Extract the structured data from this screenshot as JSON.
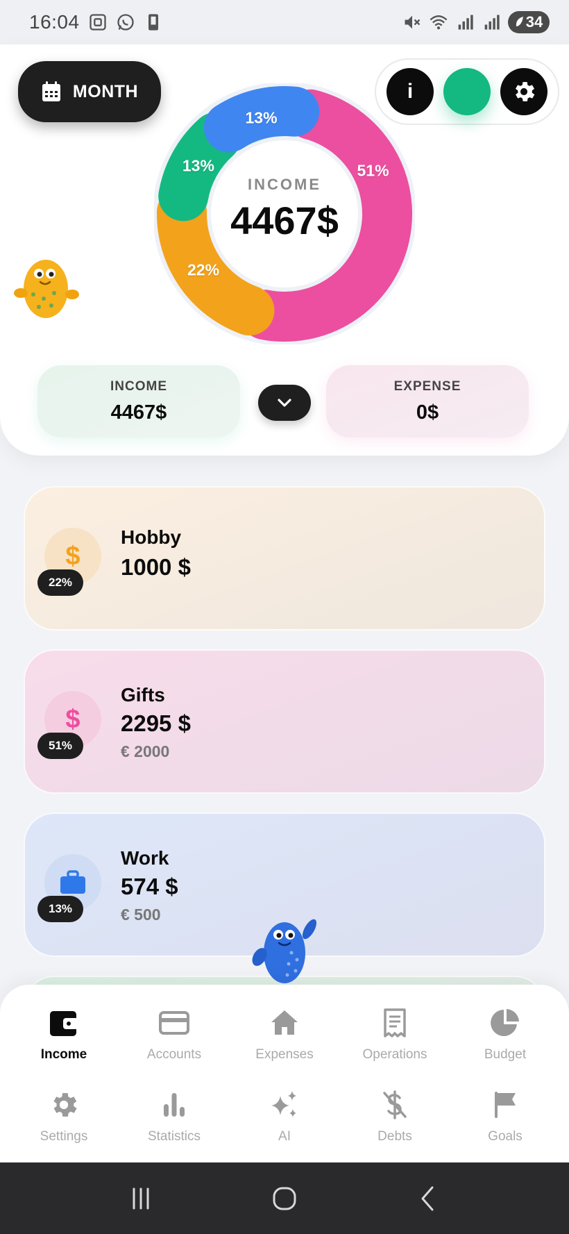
{
  "status_bar": {
    "time": "16:04",
    "battery": "34",
    "left_icons": [
      "screenshot-icon",
      "whatsapp-icon",
      "device-icon"
    ],
    "right_icons": [
      "mute-icon",
      "wifi-icon",
      "signal-icon",
      "signal-icon"
    ]
  },
  "header": {
    "period_label": "MONTH",
    "info_label": "i"
  },
  "donut": {
    "center_label": "INCOME",
    "center_value": "4467$",
    "segments": [
      {
        "name": "Gifts",
        "percent": 51,
        "label": "51%",
        "color": "#ec4f9f"
      },
      {
        "name": "Hobby",
        "percent": 22,
        "label": "22%",
        "color": "#f3a21c"
      },
      {
        "name": "",
        "percent": 13,
        "label": "13%",
        "color": "#14b982"
      },
      {
        "name": "Work",
        "percent": 13,
        "label": "13%",
        "color": "#3f86f1"
      }
    ]
  },
  "summary": {
    "income_label": "INCOME",
    "income_value": "4467$",
    "expense_label": "EXPENSE",
    "expense_value": "0$"
  },
  "categories": [
    {
      "name": "Hobby",
      "amount": "1000 $",
      "budget": "",
      "percent": "22%",
      "icon": "dollar-icon",
      "color": "#f3a21c"
    },
    {
      "name": "Gifts",
      "amount": "2295 $",
      "budget": "€ 2000",
      "percent": "51%",
      "icon": "dollar-icon",
      "color": "#ec4f9f"
    },
    {
      "name": "Work",
      "amount": "574 $",
      "budget": "€ 500",
      "percent": "13%",
      "icon": "briefcase-icon",
      "color": "#3f86f1"
    }
  ],
  "nav": {
    "row1": [
      {
        "label": "Income",
        "icon": "wallet-icon",
        "active": true
      },
      {
        "label": "Accounts",
        "icon": "card-icon",
        "active": false
      },
      {
        "label": "Expenses",
        "icon": "home-icon",
        "active": false
      },
      {
        "label": "Operations",
        "icon": "receipt-icon",
        "active": false
      },
      {
        "label": "Budget",
        "icon": "pie-icon",
        "active": false
      }
    ],
    "row2": [
      {
        "label": "Settings",
        "icon": "gear-icon",
        "active": false
      },
      {
        "label": "Statistics",
        "icon": "bar-chart-icon",
        "active": false
      },
      {
        "label": "AI",
        "icon": "sparkle-icon",
        "active": false
      },
      {
        "label": "Debts",
        "icon": "no-dollar-icon",
        "active": false
      },
      {
        "label": "Goals",
        "icon": "flag-icon",
        "active": false
      }
    ]
  },
  "colors": {
    "accent_dark": "#1f1f20",
    "accent_green": "#13b981",
    "inactive_icon": "#9a9a9a"
  }
}
